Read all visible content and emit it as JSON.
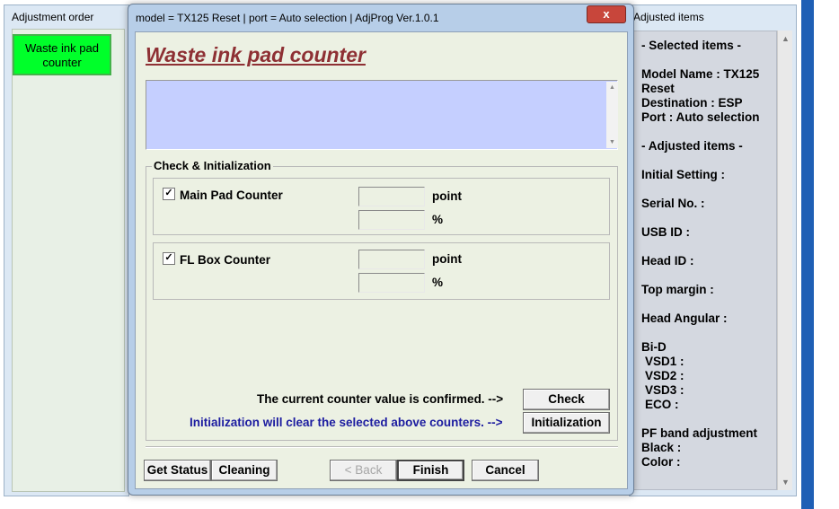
{
  "left_window": {
    "title": "Adjustment order",
    "item": "Waste ink pad counter"
  },
  "right_window": {
    "title": "Adjusted items",
    "items": [
      "- Selected items -",
      "Model Name : TX125",
      "Reset",
      "Destination : ESP",
      "Port : Auto selection",
      "- Adjusted items -",
      "Initial Setting :",
      "Serial No. :",
      "USB ID :",
      "Head ID :",
      "Top margin :",
      "Head Angular :",
      "Bi-D",
      " VSD1 :",
      " VSD2 :",
      " VSD3 :",
      " ECO  :",
      "PF band adjustment",
      "Black :",
      "Color :"
    ]
  },
  "dialog": {
    "title": "model = TX125 Reset | port = Auto selection | AdjProg Ver.1.0.1",
    "close_label": "x",
    "heading": "Waste ink pad counter",
    "group_label": "Check & Initialization",
    "main_pad": {
      "label": "Main Pad Counter",
      "checked": true,
      "point_value": "",
      "percent_value": "",
      "point_unit": "point",
      "percent_unit": "%"
    },
    "fl_box": {
      "label": "FL Box Counter",
      "checked": true,
      "point_value": "",
      "percent_value": "",
      "point_unit": "point",
      "percent_unit": "%"
    },
    "check_line": "The current counter value is confirmed. -->",
    "init_line": "Initialization will clear the selected above counters. -->",
    "buttons": {
      "check": "Check",
      "initialization": "Initialization",
      "get_status": "Get Status",
      "cleaning": "Cleaning",
      "back": "< Back",
      "finish": "Finish",
      "cancel": "Cancel"
    }
  }
}
